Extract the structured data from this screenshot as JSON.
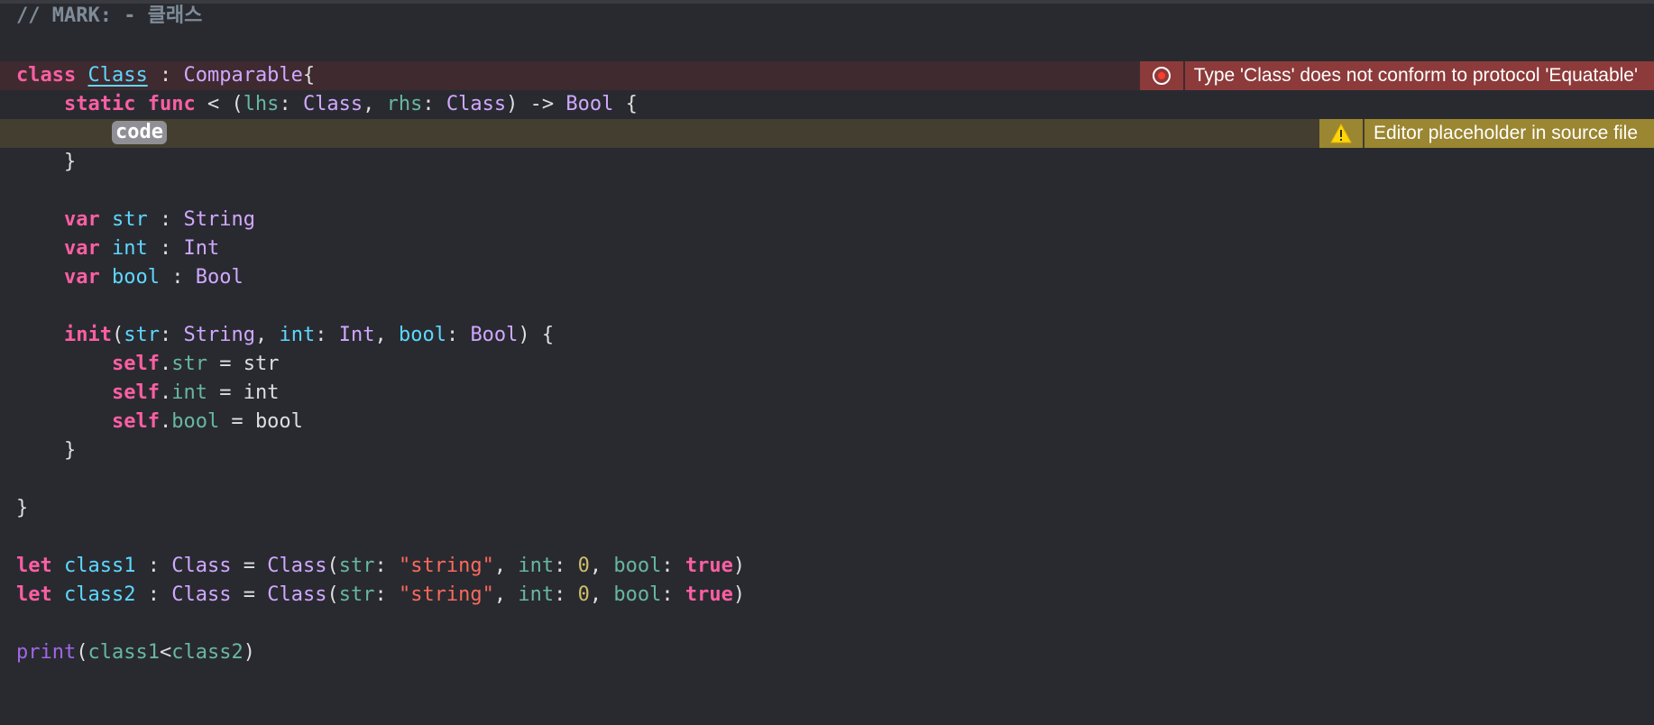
{
  "theme": {
    "background": "#292a30",
    "error_line": "#3f2a30",
    "warning_line": "#433e30",
    "error_badge": "#8d3a3a",
    "warning_badge": "#9b8631"
  },
  "code": {
    "mark_comment": "// MARK: - 클래스",
    "line_class": {
      "kw": "class",
      "name": "Class",
      "sep": " : ",
      "proto": "Comparable",
      "brace": "{"
    },
    "line_func": {
      "kw1": "static",
      "kw2": "func",
      "op": " < (",
      "p1": "lhs",
      "c1": ": ",
      "t1": "Class",
      "comma": ", ",
      "p2": "rhs",
      "c2": ": ",
      "t2": "Class",
      "arrow": ") -> ",
      "ret": "Bool",
      "brace": " {"
    },
    "placeholder": "code",
    "close_func": "}",
    "var_str": {
      "kw": "var",
      "name": "str",
      "sep": " : ",
      "type": "String"
    },
    "var_int": {
      "kw": "var",
      "name": "int",
      "sep": " : ",
      "type": "Int"
    },
    "var_bool": {
      "kw": "var",
      "name": "bool",
      "sep": " : ",
      "type": "Bool"
    },
    "init_line": {
      "kw": "init",
      "open": "(",
      "p1": "str",
      "c1": ": ",
      "t1": "String",
      "comma1": ", ",
      "p2": "int",
      "c2": ": ",
      "t2": "Int",
      "comma2": ", ",
      "p3": "bool",
      "c3": ": ",
      "t3": "Bool",
      "close": ") {"
    },
    "self_str": {
      "kw": "self",
      "dot": ".",
      "prop": "str",
      "assign": " = ",
      "val": "str"
    },
    "self_int": {
      "kw": "self",
      "dot": ".",
      "prop": "int",
      "assign": " = ",
      "val": "int"
    },
    "self_bool": {
      "kw": "self",
      "dot": ".",
      "prop": "bool",
      "assign": " = ",
      "val": "bool"
    },
    "close_init": "}",
    "close_class": "}",
    "let1": {
      "kw": "let",
      "name": "class1",
      "sep": " : ",
      "type": "Class",
      "eq": " = ",
      "ctor": "Class",
      "open": "(",
      "a1": "str",
      "c1": ": ",
      "s1": "\"string\"",
      "comma1": ", ",
      "a2": "int",
      "c2": ": ",
      "n2": "0",
      "comma2": ", ",
      "a3": "bool",
      "c3": ": ",
      "b3": "true",
      "close": ")"
    },
    "let2": {
      "kw": "let",
      "name": "class2",
      "sep": " : ",
      "type": "Class",
      "eq": " = ",
      "ctor": "Class",
      "open": "(",
      "a1": "str",
      "c1": ": ",
      "s1": "\"string\"",
      "comma1": ", ",
      "a2": "int",
      "c2": ": ",
      "n2": "0",
      "comma2": ", ",
      "a3": "bool",
      "c3": ": ",
      "b3": "true",
      "close": ")"
    },
    "print_line": {
      "fn": "print",
      "open": "(",
      "a": "class1",
      "op": "<",
      "b": "class2",
      "close": ")"
    }
  },
  "issues": {
    "error": {
      "icon": "error-circle-icon",
      "message": "Type 'Class' does not conform to protocol 'Equatable'"
    },
    "warning": {
      "icon": "warning-triangle-icon",
      "message": "Editor placeholder in source file"
    }
  }
}
